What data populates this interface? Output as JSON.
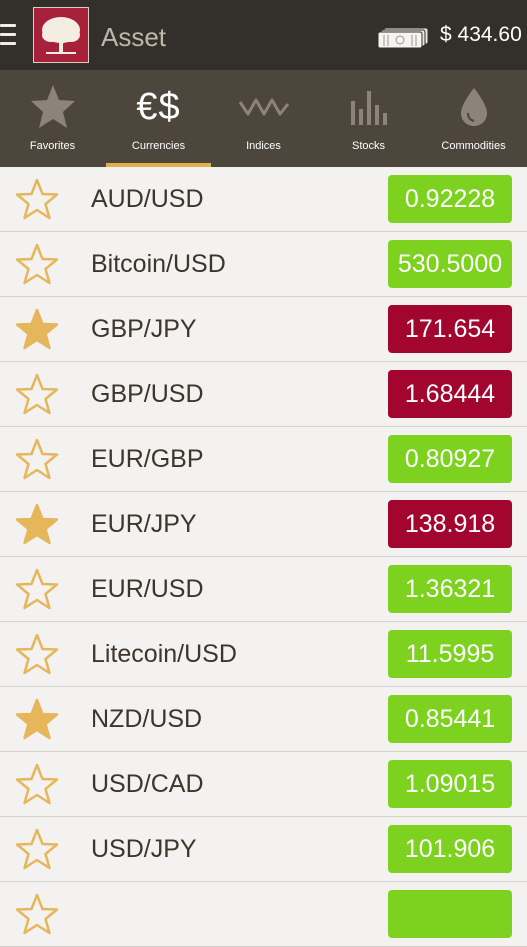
{
  "header": {
    "title": "Asset",
    "balance": "$ 434.60"
  },
  "tabs": [
    {
      "label": "Favorites",
      "icon": "star-icon",
      "active": false
    },
    {
      "label": "Currencies",
      "icon": "currency-icon",
      "glyph": "€$",
      "active": true
    },
    {
      "label": "Indices",
      "icon": "zigzag-icon",
      "active": false
    },
    {
      "label": "Stocks",
      "icon": "bar-chart-icon",
      "active": false
    },
    {
      "label": "Commodities",
      "icon": "drop-icon",
      "active": false
    }
  ],
  "assets": [
    {
      "pair": "AUD/USD",
      "price": "0.92228",
      "trend": "up",
      "favorite": false
    },
    {
      "pair": "Bitcoin/USD",
      "price": "530.5000",
      "trend": "up",
      "favorite": false
    },
    {
      "pair": "GBP/JPY",
      "price": "171.654",
      "trend": "down",
      "favorite": true
    },
    {
      "pair": "GBP/USD",
      "price": "1.68444",
      "trend": "down",
      "favorite": false
    },
    {
      "pair": "EUR/GBP",
      "price": "0.80927",
      "trend": "up",
      "favorite": false
    },
    {
      "pair": "EUR/JPY",
      "price": "138.918",
      "trend": "down",
      "favorite": true
    },
    {
      "pair": "EUR/USD",
      "price": "1.36321",
      "trend": "up",
      "favorite": false
    },
    {
      "pair": "Litecoin/USD",
      "price": "11.5995",
      "trend": "up",
      "favorite": false
    },
    {
      "pair": "NZD/USD",
      "price": "0.85441",
      "trend": "up",
      "favorite": true
    },
    {
      "pair": "USD/CAD",
      "price": "1.09015",
      "trend": "up",
      "favorite": false
    },
    {
      "pair": "USD/JPY",
      "price": "101.906",
      "trend": "up",
      "favorite": false
    },
    {
      "pair": "",
      "price": "",
      "trend": "up",
      "favorite": false
    }
  ],
  "colors": {
    "up": "#7dd21f",
    "down": "#a2062f",
    "star": "#e5b75a",
    "accent": "#e0b04c"
  }
}
